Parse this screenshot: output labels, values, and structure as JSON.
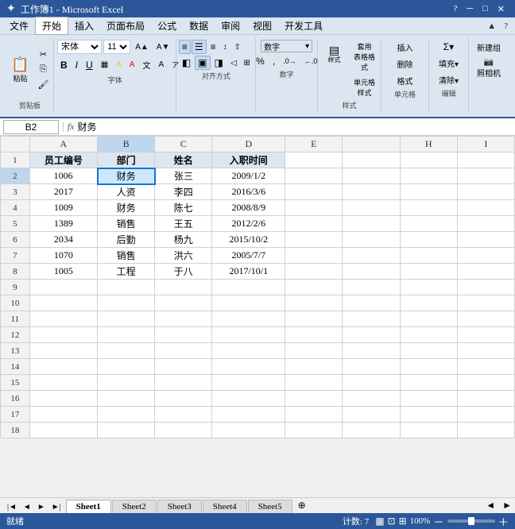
{
  "title": "Microsoft Excel",
  "file_name": "工作簿1",
  "menu": {
    "items": [
      "文件",
      "开始",
      "插入",
      "页面布局",
      "公式",
      "数据",
      "审阅",
      "视图",
      "开发工具"
    ]
  },
  "formula_bar": {
    "name_box": "B2",
    "formula": "财务"
  },
  "ribbon": {
    "clipboard_label": "剪贴板",
    "font_label": "字体",
    "align_label": "对齐方式",
    "number_label": "数字",
    "style_label": "样式",
    "cell_label": "单元格",
    "edit_label": "编辑",
    "photo_label": "照相机",
    "font_name": "宋体",
    "font_size": "11",
    "new_group_label": "新建组",
    "photo_btn_label": "照相机"
  },
  "columns": {
    "headers": [
      "",
      "A",
      "B",
      "C",
      "D",
      "E",
      "",
      "H",
      "I"
    ],
    "row_numbers": [
      1,
      2,
      3,
      4,
      5,
      6,
      7,
      8,
      9,
      10,
      11,
      12,
      13,
      14,
      15,
      16,
      17,
      18
    ]
  },
  "table_headers": [
    "员工编号",
    "部门",
    "姓名",
    "入职时间"
  ],
  "rows": [
    {
      "id": "1006",
      "dept": "财务",
      "name": "张三",
      "date": "2009/1/2"
    },
    {
      "id": "2017",
      "dept": "人资",
      "name": "李四",
      "date": "2016/3/6"
    },
    {
      "id": "1009",
      "dept": "财务",
      "name": "陈七",
      "date": "2008/8/9"
    },
    {
      "id": "1389",
      "dept": "销售",
      "name": "王五",
      "date": "2012/2/6"
    },
    {
      "id": "2034",
      "dept": "后勤",
      "name": "杨九",
      "date": "2015/10/2"
    },
    {
      "id": "1070",
      "dept": "销售",
      "name": "洪六",
      "date": "2005/7/7"
    },
    {
      "id": "1005",
      "dept": "工程",
      "name": "于八",
      "date": "2017/10/1"
    }
  ],
  "sheet_tabs": [
    "Sheet1",
    "Sheet2",
    "Sheet3",
    "Sheet4",
    "Sheet5"
  ],
  "active_sheet": "Sheet1",
  "status": {
    "left": "就绪",
    "count_label": "计数: 7",
    "zoom": "100%"
  },
  "title_bar": {
    "file_name": "工作簿1 - Microsoft Excel",
    "min_btn": "─",
    "max_btn": "□",
    "close_btn": "✕"
  }
}
